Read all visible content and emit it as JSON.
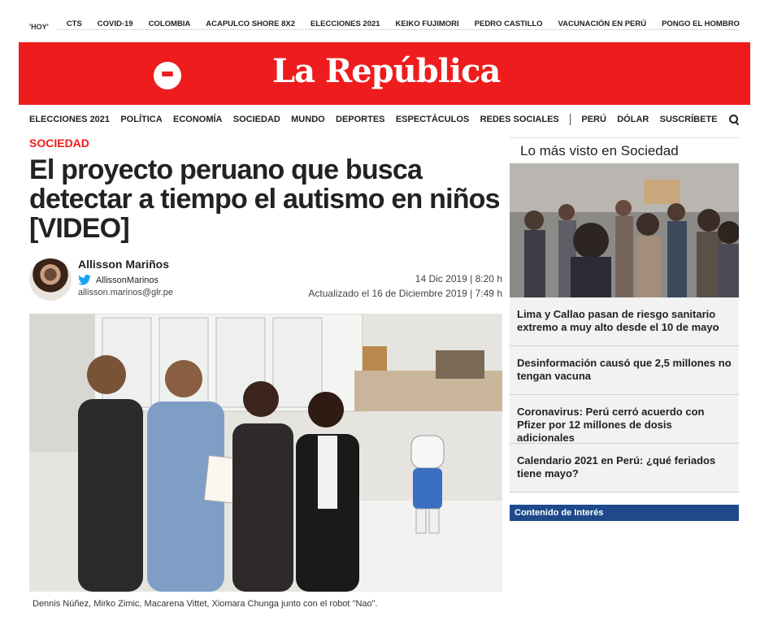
{
  "trending": {
    "hoy_label": "'HOY'",
    "items": [
      "CTS",
      "COVID-19",
      "COLOMBIA",
      "ACAPULCO SHORE 8X2",
      "ELECCIONES 2021",
      "KEIKO FUJIMORI",
      "PEDRO CASTILLO",
      "VACUNACIÓN EN PERÚ",
      "PONGO EL HOMBRO"
    ]
  },
  "header": {
    "logo": "La República",
    "brand_color": "#ee1c1c"
  },
  "nav": {
    "items": [
      "ELECCIONES 2021",
      "POLÍTICA",
      "ECONOMÍA",
      "SOCIEDAD",
      "MUNDO",
      "DEPORTES",
      "ESPECTÁCULOS",
      "REDES SOCIALES",
      "PERÚ",
      "DÓLAR",
      "SUSCRÍBETE"
    ]
  },
  "article": {
    "section": "SOCIEDAD",
    "title": "El proyecto peruano que busca detectar a tiempo el autismo en niños [VIDEO]",
    "author_name": "Allisson Mariños",
    "twitter_handle": "AllissonMarinos",
    "email": "allisson.marinos@glr.pe",
    "published": "14 Dic 2019 | 8:20 h",
    "updated": "Actualizado el 16 de Diciembre 2019 | 7:49 h",
    "caption": "Dennis Núñez, Mirko Zimic, Macarena Vittet, Xiomara Chunga junto con el robot \"Nao\"."
  },
  "sidebar": {
    "title": "Lo más visto en Sociedad",
    "items": [
      "Lima y Callao pasan de riesgo sanitario extremo a muy alto desde el 10 de mayo",
      "Desinformación causó que 2,5 millones no tengan vacuna",
      "Coronavirus: Perú cerró acuerdo con Pfizer por 12 millones de dosis adicionales",
      "Calendario 2021 en Perú: ¿qué feriados tiene mayo?"
    ],
    "interest_label": "Contenido de Interés",
    "interest_color": "#1e4a8c"
  }
}
